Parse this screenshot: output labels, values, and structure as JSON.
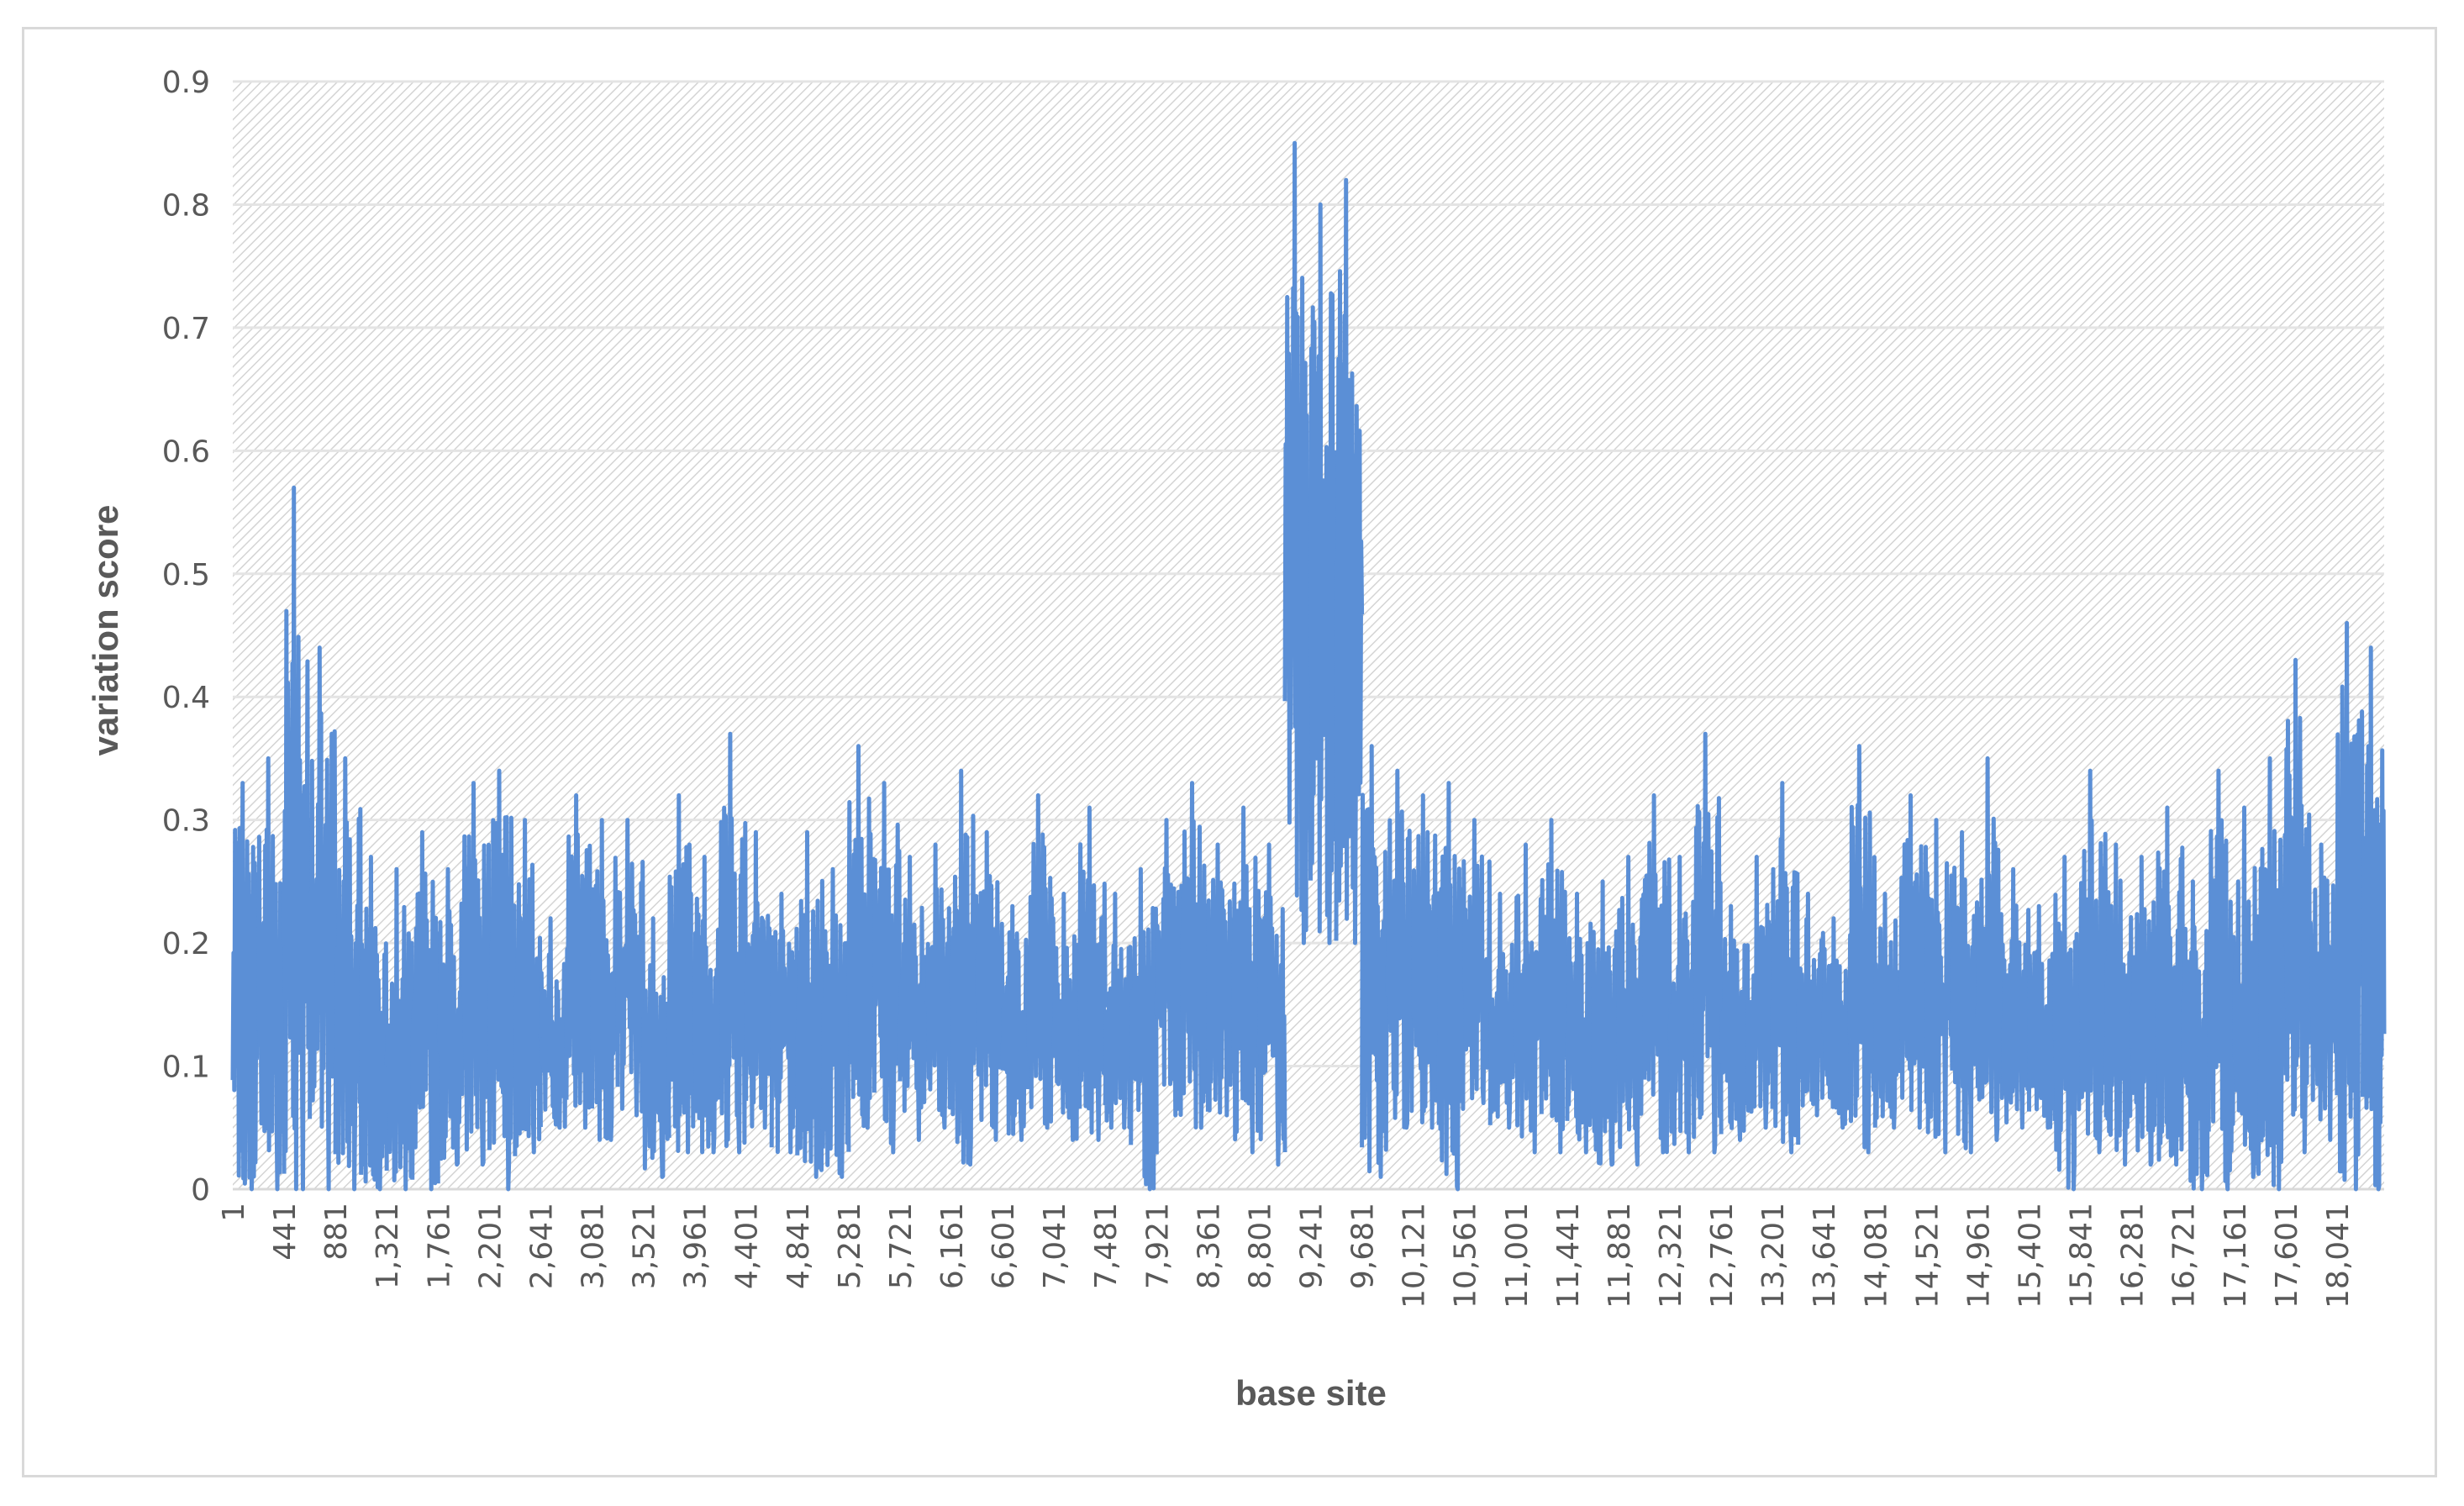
{
  "chart_data": {
    "type": "line",
    "title": "",
    "xlabel": "base site",
    "ylabel": "variation score",
    "ylim": [
      0,
      0.9
    ],
    "xlim": [
      1,
      18445
    ],
    "yticks": [
      "0",
      "0.1",
      "0.2",
      "0.3",
      "0.4",
      "0.5",
      "0.6",
      "0.7",
      "0.8",
      "0.9"
    ],
    "xticks": [
      "1",
      "441",
      "881",
      "1,321",
      "1,761",
      "2,201",
      "2,641",
      "3,081",
      "3,521",
      "3,961",
      "4,401",
      "4,841",
      "5,281",
      "5,721",
      "6,161",
      "6,601",
      "7,041",
      "7,481",
      "7,921",
      "8,361",
      "8,801",
      "9,241",
      "9,681",
      "10,121",
      "10,561",
      "11,001",
      "11,441",
      "11,881",
      "12,321",
      "12,761",
      "13,201",
      "13,641",
      "14,081",
      "14,521",
      "14,961",
      "15,401",
      "15,841",
      "16,281",
      "16,721",
      "17,161",
      "17,601",
      "18,041"
    ],
    "grid": true,
    "legend": "none",
    "series_color": "#5b8fd6",
    "series": [
      {
        "name": "variation score",
        "bin_size": 220,
        "high": [
          0.33,
          0.35,
          0.57,
          0.44,
          0.35,
          0.27,
          0.26,
          0.29,
          0.26,
          0.33,
          0.34,
          0.3,
          0.22,
          0.32,
          0.3,
          0.3,
          0.22,
          0.32,
          0.27,
          0.37,
          0.29,
          0.24,
          0.29,
          0.26,
          0.36,
          0.33,
          0.27,
          0.28,
          0.34,
          0.29,
          0.23,
          0.32,
          0.24,
          0.31,
          0.24,
          0.26,
          0.3,
          0.33,
          0.28,
          0.31,
          0.28,
          0.85,
          0.8,
          0.82,
          0.36,
          0.34,
          0.32,
          0.33,
          0.3,
          0.24,
          0.28,
          0.3,
          0.24,
          0.25,
          0.27,
          0.32,
          0.27,
          0.37,
          0.23,
          0.27,
          0.33,
          0.24,
          0.22,
          0.36,
          0.24,
          0.32,
          0.3,
          0.29,
          0.35,
          0.26,
          0.23,
          0.27,
          0.34,
          0.28,
          0.27,
          0.31,
          0.25,
          0.34,
          0.31,
          0.35,
          0.43,
          0.28,
          0.46,
          0.44
        ],
        "low": [
          0,
          0,
          0,
          0,
          0,
          0,
          0,
          0,
          0.02,
          0.02,
          0,
          0.03,
          0.05,
          0.05,
          0.04,
          0.06,
          0.01,
          0.03,
          0.03,
          0.03,
          0.05,
          0.03,
          0.01,
          0.01,
          0.05,
          0.03,
          0.04,
          0.05,
          0.02,
          0.04,
          0.04,
          0.05,
          0.04,
          0.04,
          0.05,
          0,
          0.06,
          0.05,
          0.06,
          0.03,
          0.02,
          0.2,
          0.2,
          0.2,
          0.01,
          0.05,
          0.05,
          0,
          0.07,
          0.05,
          0.03,
          0.03,
          0.03,
          0.02,
          0.02,
          0.03,
          0.03,
          0.03,
          0.04,
          0.05,
          0.03,
          0.06,
          0.05,
          0.03,
          0.05,
          0.05,
          0.03,
          0.03,
          0.04,
          0.05,
          0.05,
          0,
          0.03,
          0.02,
          0.02,
          0.02,
          0,
          0,
          0.01,
          0,
          0.03,
          0.04,
          0,
          0
        ]
      }
    ]
  }
}
